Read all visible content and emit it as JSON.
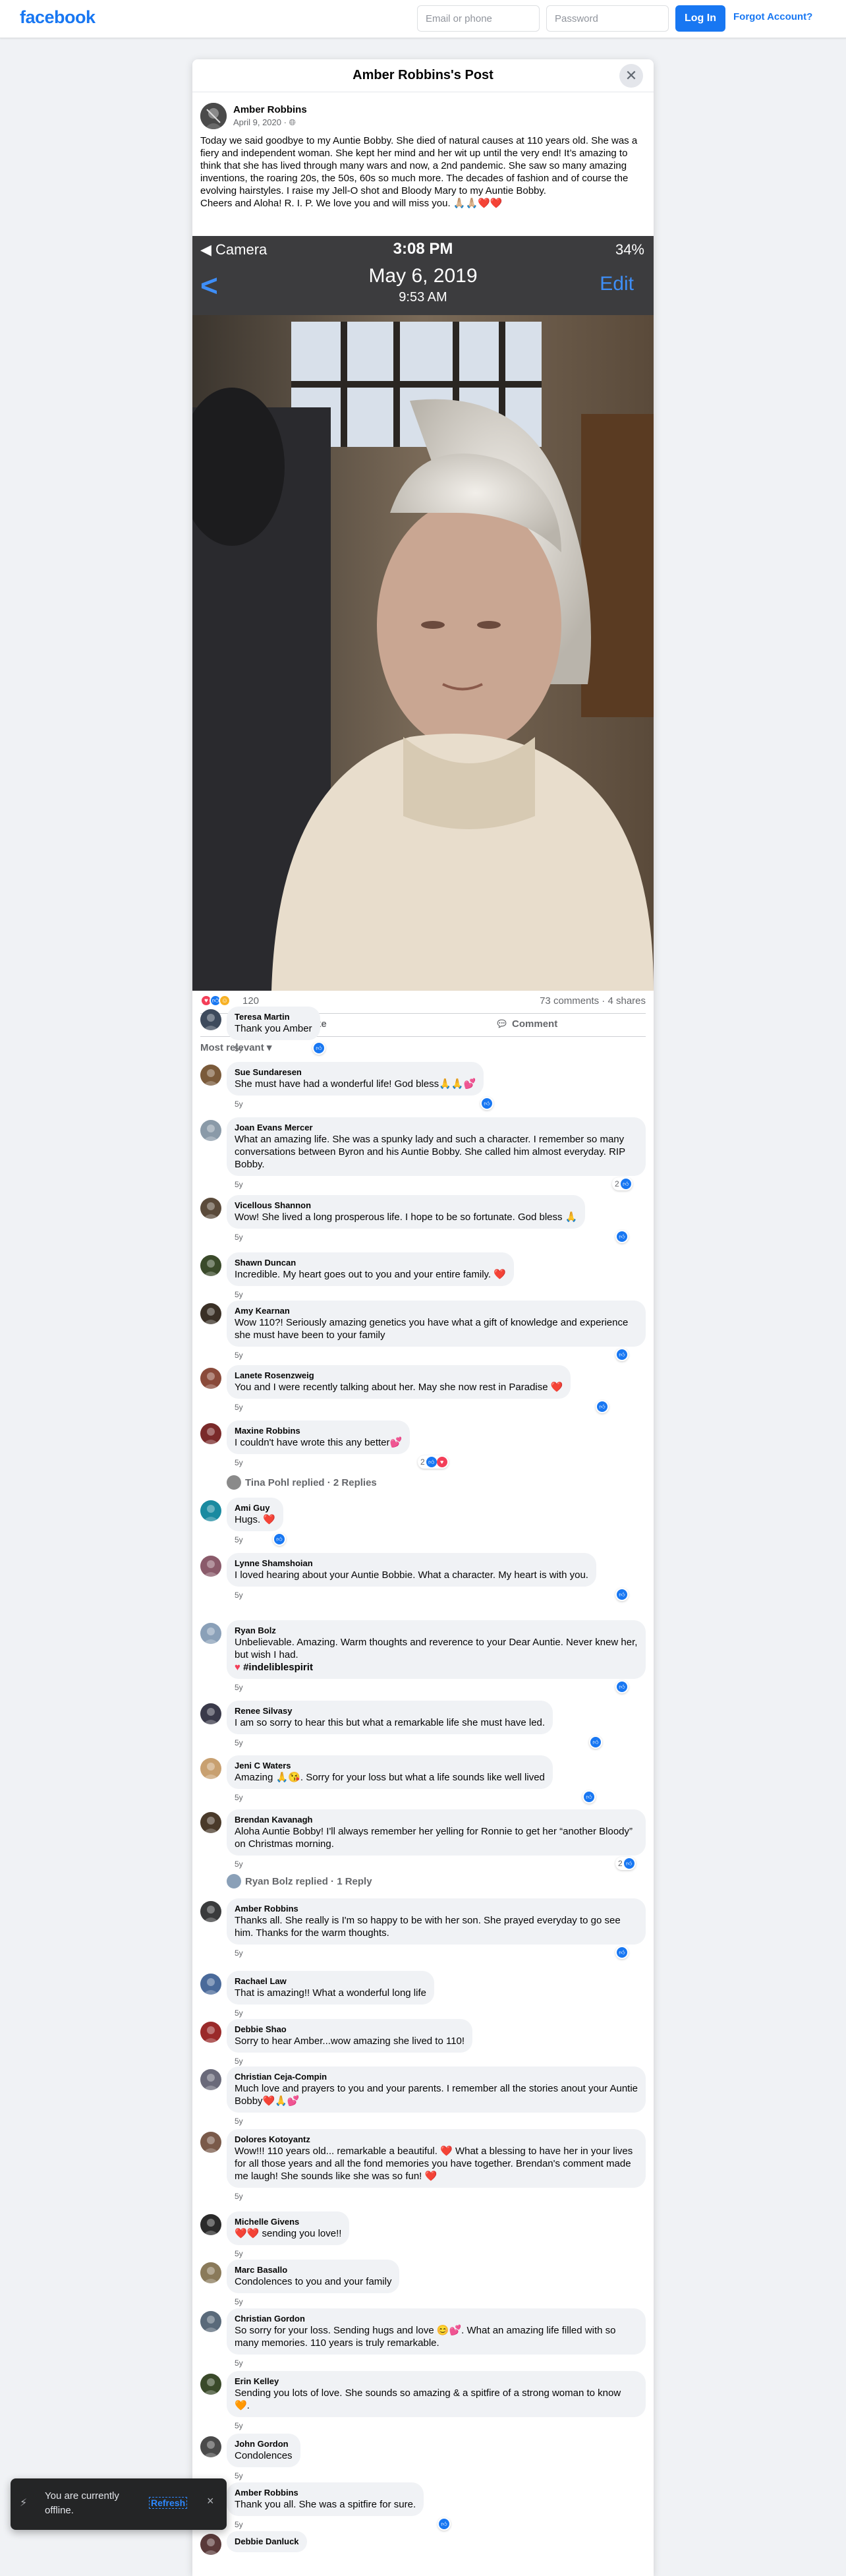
{
  "topbar": {
    "logo": "facebook",
    "email_placeholder": "Email or phone",
    "password_placeholder": "Password",
    "login_label": "Log In",
    "forgot_label": "Forgot Account?"
  },
  "modal": {
    "title": "Amber Robbins's Post",
    "close_icon": "close-icon"
  },
  "post": {
    "author": "Amber Robbins",
    "date": "April 9, 2020 · ",
    "privacy_icon": "globe-icon",
    "text_lines": [
      "Today we said goodbye to my Auntie Bobby. She died of natural causes at 110 years old. She was a fiery and independent woman. She kept her mind and her wit up until the very end! It’s amazing to think that she has lived through many wars and now, a 2nd pandemic. She saw so many amazing inventions, the roaring 20s, the 50s, 60s so much more. The decades of fashion and of course the evolving hairstyles. I  raise my Jell-O shot and Bloody Mary to my Auntie Bobby.",
      "Cheers and Aloha!  R. I. P.  We love you and will miss you. 🙏🏼🙏🏼❤️❤️"
    ]
  },
  "photo": {
    "status_left": "◀ Camera",
    "status_time": "3:08 PM",
    "status_right": "34%",
    "date": "May 6, 2019",
    "time": "9:53 AM",
    "back": "<",
    "edit": "Edit"
  },
  "stats": {
    "reaction_count": "120",
    "comments_shares": "73 comments · 4 shares"
  },
  "actions": {
    "like": "Like",
    "comment": "Comment",
    "sort": "Most relevant"
  },
  "comments": [
    {
      "name": "Teresa Martin",
      "text": "Thank you Amber",
      "time": "5y"
    },
    {
      "name": "Sue Sundaresen",
      "text": "She must have had a wonderful life! God bless🙏🙏💕",
      "time": "5y"
    },
    {
      "name": "Joan Evans Mercer",
      "text": "What an amazing life. She was a spunky lady and such a character. I remember so many conversations between Byron and his Auntie Bobby. She called him almost everyday. RIP Bobby.",
      "time": "5y",
      "react_count": "2"
    },
    {
      "name": "Vicellous Shannon",
      "text": "Wow! She lived a long prosperous life. I hope to be so fortunate. God bless 🙏",
      "time": "5y"
    },
    {
      "name": "Shawn Duncan",
      "text": "Incredible. My heart goes out to you and your entire family. ❤️",
      "time": "5y"
    },
    {
      "name": "Amy Kearnan",
      "text": "Wow 110?! Seriously amazing genetics you have what a gift of knowledge and experience she must have been to your family",
      "time": "5y"
    },
    {
      "name": "Lanete Rosenzweig",
      "text": "You and I were recently talking about her. May she now rest in Paradise ❤️",
      "time": "5y"
    },
    {
      "name": "Maxine Robbins",
      "text": "I couldn't have wrote this any better💕",
      "time": "5y",
      "react_count": "2"
    },
    {
      "name": "Ami Guy",
      "text": "Hugs. ❤️",
      "time": "5y"
    },
    {
      "name": "Lynne Shamshoian",
      "text": "I loved hearing about your Auntie Bobbie. What a character. My heart is with you.",
      "time": "5y"
    },
    {
      "name": "Ryan Bolz",
      "text": "Unbelievable. Amazing. Warm thoughts and reverence to your Dear Auntie. Never knew her, but wish I had.",
      "hashtag": "#indeliblespirit",
      "time": "5y"
    },
    {
      "name": "Renee Silvasy",
      "text": "I am so sorry to hear this but what a remarkable life she must have led.",
      "time": "5y"
    },
    {
      "name": "Jeni C Waters",
      "text": "Amazing 🙏😘. Sorry for your loss but what a life sounds like well lived",
      "time": "5y"
    },
    {
      "name": "Brendan Kavanagh",
      "text": "Aloha Auntie Bobby! I'll always remember her yelling for Ronnie to get her “another Bloody” on Christmas morning.",
      "time": "5y",
      "react_count": "2"
    },
    {
      "name": "Amber Robbins",
      "text": "Thanks all. She really is I'm so happy to be with her son. She prayed everyday to go see him. Thanks for the warm thoughts.",
      "time": "5y"
    },
    {
      "name": "Rachael Law",
      "text": "That is amazing!! What a wonderful long life",
      "time": "5y"
    },
    {
      "name": "Debbie Shao",
      "text": "Sorry to hear Amber...wow amazing she lived to 110!",
      "time": "5y"
    },
    {
      "name": "Christian Ceja-Compin",
      "text": "Much love and prayers to you and your parents. I remember all the stories anout your Auntie Bobby❤️🙏💕",
      "time": "5y"
    },
    {
      "name": "Dolores Kotoyantz",
      "text": "Wow!!! 110 years old... remarkable a beautiful. ❤️ What a blessing to have her in your lives for all those years and all the fond memories you have together. Brendan's comment made me laugh! She sounds like she was so fun! ❤️",
      "time": "5y"
    },
    {
      "name": "Michelle Givens",
      "text": "❤️❤️ sending you love!!",
      "time": "5y"
    },
    {
      "name": "Marc Basallo",
      "text": "Condolences to you and your family",
      "time": "5y"
    },
    {
      "name": "Christian Gordon",
      "text": "So sorry for your loss. Sending hugs and love 😊💕. What an amazing life filled with so many memories. 110 years is truly remarkable.",
      "time": "5y"
    },
    {
      "name": "Erin Kelley",
      "text": "Sending you lots of love. She sounds so amazing & a spitfire of a strong woman to know 🧡.",
      "time": "5y"
    },
    {
      "name": "John Gordon",
      "text": "Condolences",
      "time": "5y"
    },
    {
      "name": "Amber Robbins",
      "text": "Thank you all. She was a spitfire for sure.",
      "time": "5y"
    },
    {
      "name": "Debbie Danluck",
      "text": "",
      "time": ""
    }
  ],
  "reply_threads": [
    {
      "label": "Tina Pohl replied · 2 Replies"
    },
    {
      "label": "Ryan Bolz replied · 1 Reply"
    }
  ],
  "toast": {
    "text": "You are currently offline.",
    "refresh": "Refresh",
    "close": "×"
  },
  "colors": {
    "brand": "#1877f2",
    "like": "#1877f2",
    "love": "#f33e58"
  }
}
